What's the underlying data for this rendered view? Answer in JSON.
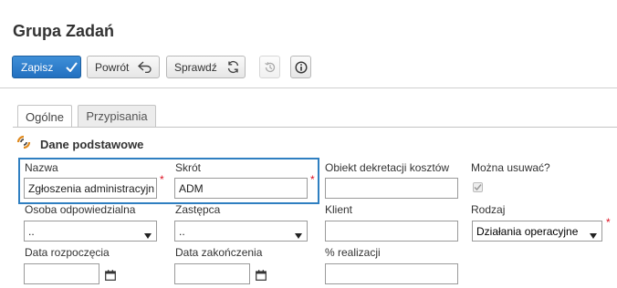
{
  "page": {
    "title": "Grupa Zadań"
  },
  "toolbar": {
    "save_label": "Zapisz",
    "back_label": "Powrót",
    "check_label": "Sprawdź"
  },
  "tabs": [
    {
      "label": "Ogólne",
      "active": true
    },
    {
      "label": "Przypisania",
      "active": false
    }
  ],
  "section": {
    "title": "Dane podstawowe"
  },
  "form": {
    "nazwa": {
      "label": "Nazwa",
      "value": "Zgłoszenia administracyjn",
      "required": true
    },
    "skrot": {
      "label": "Skrót",
      "value": "ADM",
      "required": true
    },
    "obiekt": {
      "label": "Obiekt dekretacji kosztów",
      "value": ""
    },
    "mozna_usuwac": {
      "label": "Można usuwać?",
      "checked": true,
      "disabled": true
    },
    "osoba": {
      "label": "Osoba odpowiedzialna",
      "value": ".."
    },
    "zastepca": {
      "label": "Zastępca",
      "value": ".."
    },
    "klient": {
      "label": "Klient",
      "value": ""
    },
    "rodzaj": {
      "label": "Rodzaj",
      "value": "Działania operacyjne",
      "required": true
    },
    "data_rozpoczecia": {
      "label": "Data rozpoczęcia",
      "value": ""
    },
    "data_zakonczenia": {
      "label": "Data zakończenia",
      "value": ""
    },
    "realizacja": {
      "label": "% realizacji",
      "value": ""
    }
  },
  "colors": {
    "primary": "#2270c0",
    "highlight": "#2f7fc1",
    "required": "#dd1122"
  }
}
